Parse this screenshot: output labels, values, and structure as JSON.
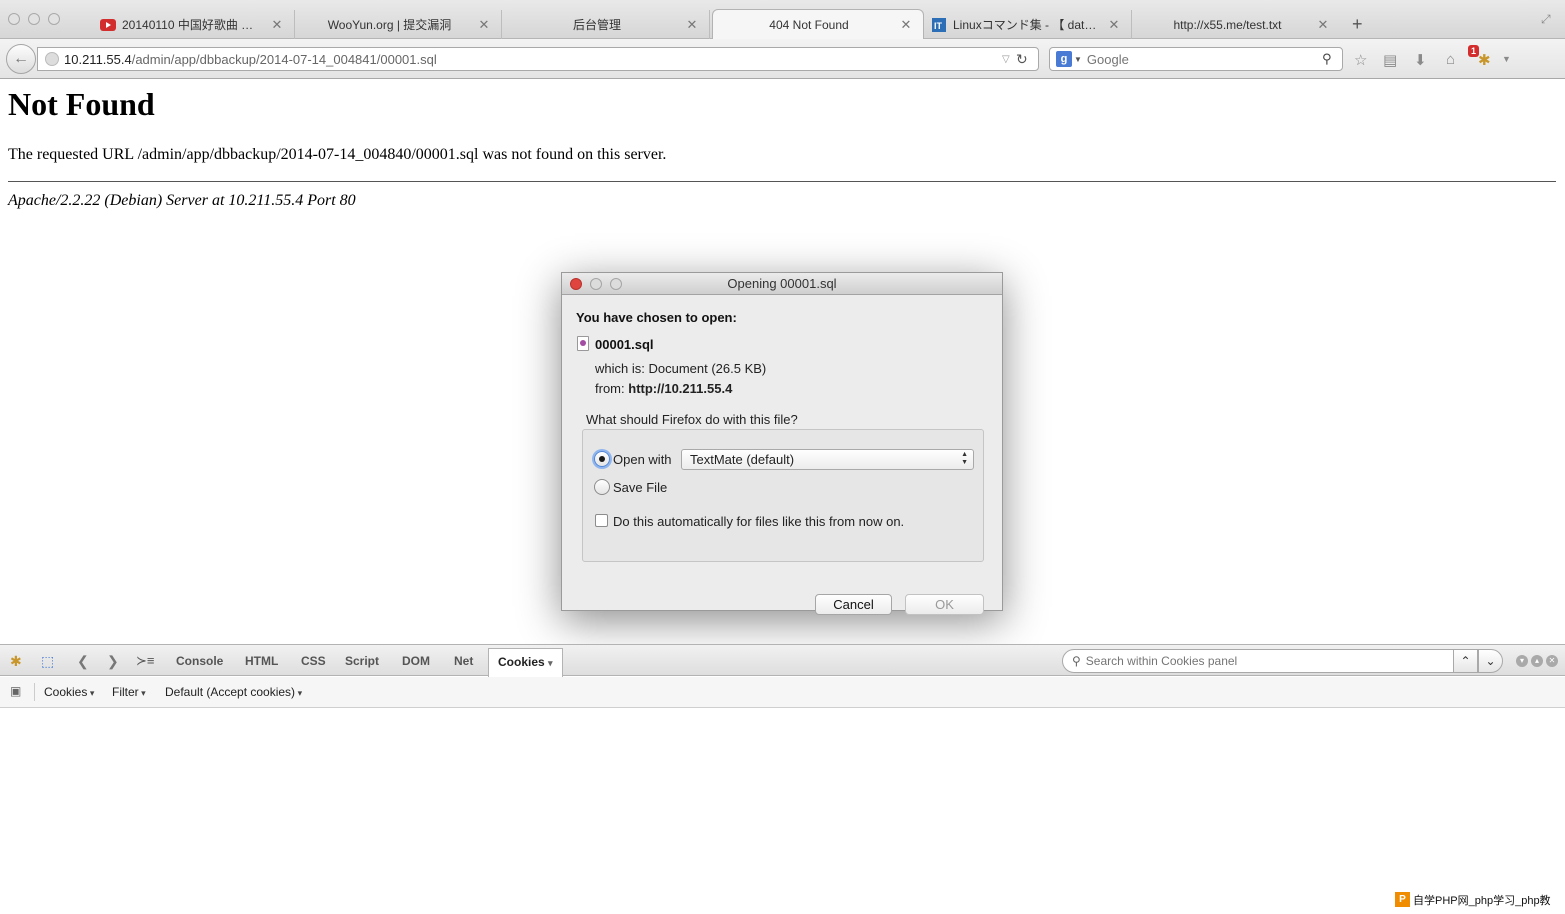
{
  "browser": {
    "tabs": [
      {
        "label": "20140110 中国好歌曲 《她…",
        "active": false
      },
      {
        "label": "WooYun.org | 提交漏洞",
        "active": false
      },
      {
        "label": "后台管理",
        "active": false
      },
      {
        "label": "404 Not Found",
        "active": true
      },
      {
        "label": "Linuxコマンド集 - 【 date …",
        "active": false
      },
      {
        "label": "http://x55.me/test.txt",
        "active": false
      }
    ],
    "url_host": "10.211.55.4",
    "url_path": "/admin/app/dbbackup/2014-07-14_004841/00001.sql",
    "search_placeholder": "Google",
    "addon_badge": "1"
  },
  "page": {
    "heading": "Not Found",
    "message": "The requested URL /admin/app/dbbackup/2014-07-14_004840/00001.sql was not found on this server.",
    "address": "Apache/2.2.22 (Debian) Server at 10.211.55.4 Port 80"
  },
  "dialog": {
    "title": "Opening 00001.sql",
    "chosen_label": "You have chosen to open:",
    "filename": "00001.sql",
    "which_is_label": "which is:",
    "which_is_value": "Document (26.5 KB)",
    "from_label": "from:",
    "from_value": "http://10.211.55.4",
    "question": "What should Firefox do with this file?",
    "open_with_label": "Open with",
    "open_with_app": "TextMate (default)",
    "save_file_label": "Save File",
    "auto_label": "Do this automatically for files like this from now on.",
    "selected_option": "open_with",
    "auto_checked": false,
    "cancel_label": "Cancel",
    "ok_label": "OK"
  },
  "firebug": {
    "tabs": [
      "Console",
      "HTML",
      "CSS",
      "Script",
      "DOM",
      "Net",
      "Cookies"
    ],
    "active_tab": "Cookies",
    "search_placeholder": "Search within Cookies panel",
    "menus": [
      "Cookies",
      "Filter",
      "Default (Accept cookies)"
    ]
  },
  "watermark": {
    "logo": "P",
    "text": "自学PHP网_php学习_php教"
  },
  "colors": {
    "tab_strip": "#dcdcdc",
    "close_light": "#e0443e",
    "radio_focus": "#4f86d8",
    "youtube": "#d22e2e",
    "it_icon": "#2c6fb6"
  }
}
